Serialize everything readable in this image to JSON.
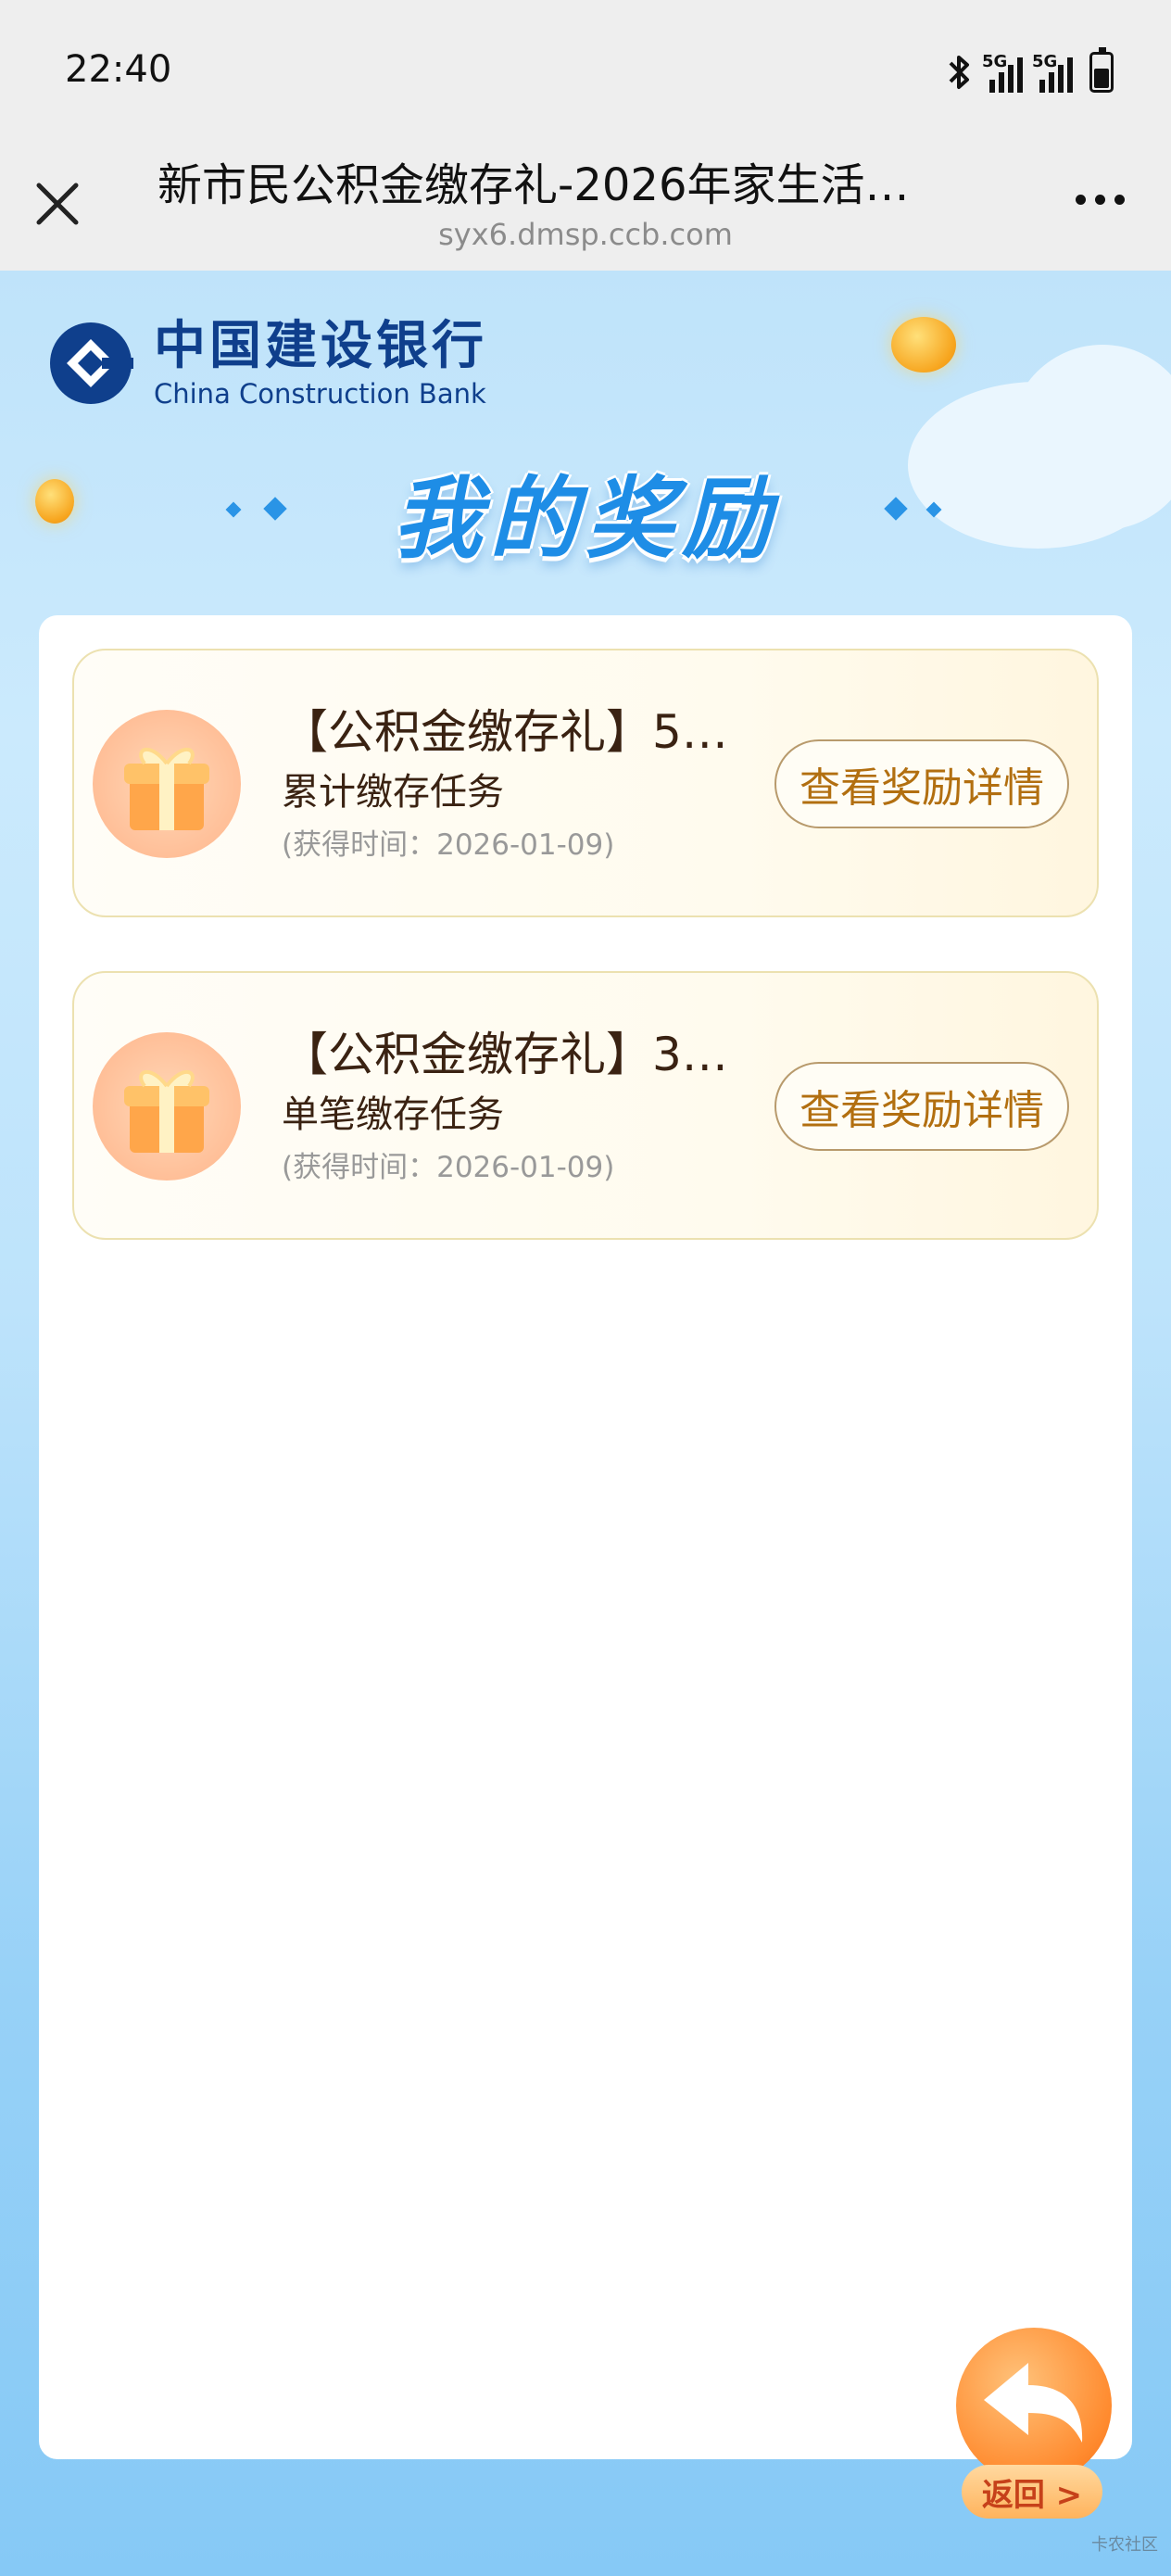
{
  "status_bar": {
    "time": "22:40",
    "network_1": "5G",
    "network_2": "5G"
  },
  "title_bar": {
    "title": "新市民公积金缴存礼-2026年家生活…",
    "url": "syx6.dmsp.ccb.com"
  },
  "header": {
    "bank_name_cn": "中国建设银行",
    "bank_name_en": "China Construction Bank",
    "page_title": "我的奖励"
  },
  "rewards": [
    {
      "title": "【公积金缴存礼】5…",
      "task": "累计缴存任务",
      "time": "(获得时间：2026-01-09)",
      "button": "查看奖励详情"
    },
    {
      "title": "【公积金缴存礼】3…",
      "task": "单笔缴存任务",
      "time": "(获得时间：2026-01-09)",
      "button": "查看奖励详情"
    }
  ],
  "back_button": {
    "label": "返回 >"
  },
  "watermark": "卡农社区",
  "colors": {
    "accent_blue": "#1e8de6",
    "brand_navy": "#0f3f8c",
    "button_text_gold": "#b26f10",
    "back_button_orange": "#ff8a2e"
  }
}
